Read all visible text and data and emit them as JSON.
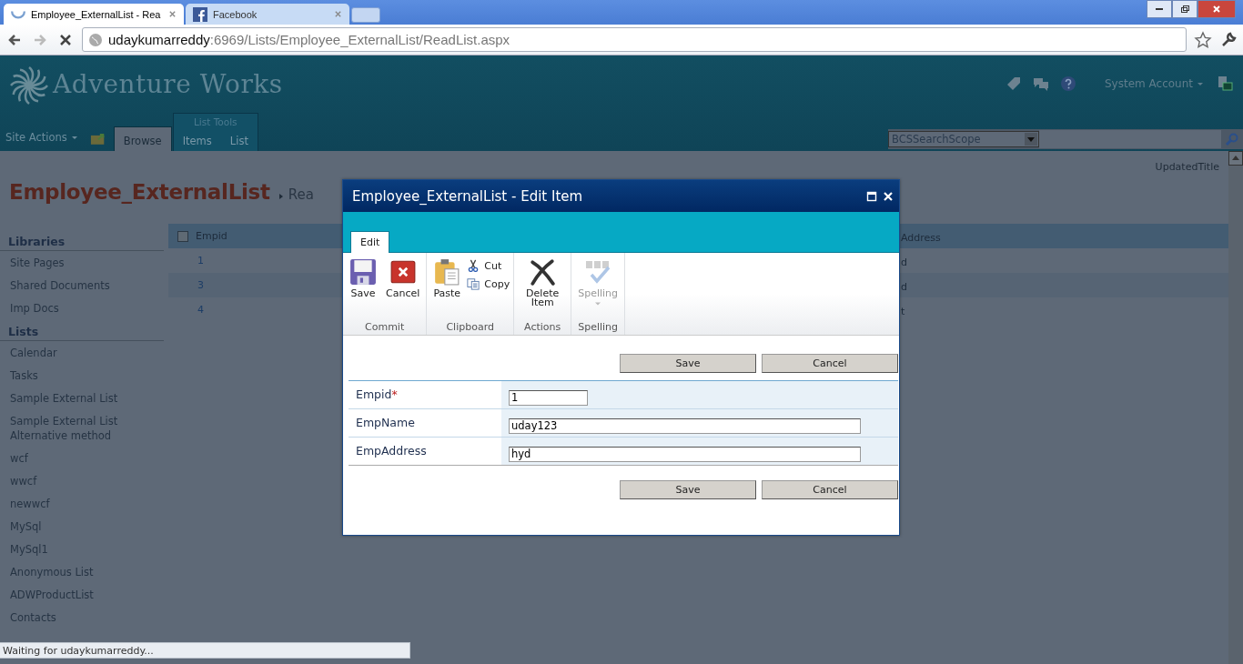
{
  "browser": {
    "tabs": [
      {
        "title": "Employee_ExternalList - Rea",
        "kind": "loading",
        "selected": true
      },
      {
        "title": "Facebook",
        "kind": "facebook",
        "selected": false
      }
    ],
    "url": {
      "host": "udaykumarreddy",
      "path": ":6969/Lists/Employee_ExternalList/ReadList.aspx"
    }
  },
  "header": {
    "logo": "Adventure Works",
    "user": "System Account",
    "site_actions": "Site Actions",
    "tabs": [
      {
        "label": "Browse",
        "selected": true
      },
      {
        "label": "Items",
        "selected": false
      },
      {
        "label": "List",
        "selected": false
      }
    ],
    "tab_group": "List Tools",
    "search_scope": "BCSSearchScope"
  },
  "page": {
    "updated_title": "UpdatedTitle",
    "title": "Employee_ExternalList",
    "breadcrumb": "Rea"
  },
  "sidebar": [
    {
      "heading": "Libraries",
      "items": [
        "Site Pages",
        "Shared Documents",
        "Imp Docs"
      ]
    },
    {
      "heading": "Lists",
      "items": [
        "Calendar",
        "Tasks",
        "Sample External List",
        "Sample External List Alternative method",
        "wcf",
        "wwcf",
        "newwcf",
        "MySql",
        "MySql1",
        "Anonymous List",
        "ADWProductList",
        "Contacts"
      ]
    }
  ],
  "list": {
    "all_selected": false,
    "columns": [
      "Empid",
      "Address"
    ],
    "rows": [
      {
        "empid": "1",
        "address": "d"
      },
      {
        "empid": "3",
        "address": "d"
      },
      {
        "empid": "4",
        "address": "t"
      }
    ]
  },
  "dialog": {
    "title": "Employee_ExternalList - Edit Item",
    "tabs": [
      {
        "label": "Edit",
        "selected": true
      }
    ],
    "groups": [
      {
        "label": "Commit",
        "buttons": [
          {
            "label": "Save",
            "kind": "save",
            "disabled": false
          },
          {
            "label": "Cancel",
            "kind": "cancel",
            "disabled": false
          }
        ]
      },
      {
        "label": "Clipboard",
        "buttons": [
          {
            "label": "Paste",
            "kind": "paste",
            "disabled": false
          }
        ],
        "small_buttons": [
          {
            "label": "Cut",
            "kind": "cut",
            "disabled": false
          },
          {
            "label": "Copy",
            "kind": "copy",
            "disabled": false
          }
        ]
      },
      {
        "label": "Actions",
        "buttons": [
          {
            "label": "Delete Item",
            "kind": "delete",
            "disabled": false
          }
        ]
      },
      {
        "label": "Spelling",
        "buttons": [
          {
            "label": "Spelling",
            "kind": "spelling",
            "disabled": true
          }
        ]
      }
    ],
    "top_buttons": [
      "Save",
      "Cancel"
    ],
    "required_mark": "*",
    "fields": [
      {
        "label": "Empid",
        "required": true,
        "value": "1",
        "kind": "short"
      },
      {
        "label": "EmpName",
        "required": false,
        "value": "uday123",
        "kind": "long"
      },
      {
        "label": "EmpAddress",
        "required": false,
        "value": "hyd",
        "kind": "long"
      }
    ],
    "bottom_buttons": [
      "Save",
      "Cancel"
    ]
  },
  "status": "Waiting for udaykumarreddy..."
}
